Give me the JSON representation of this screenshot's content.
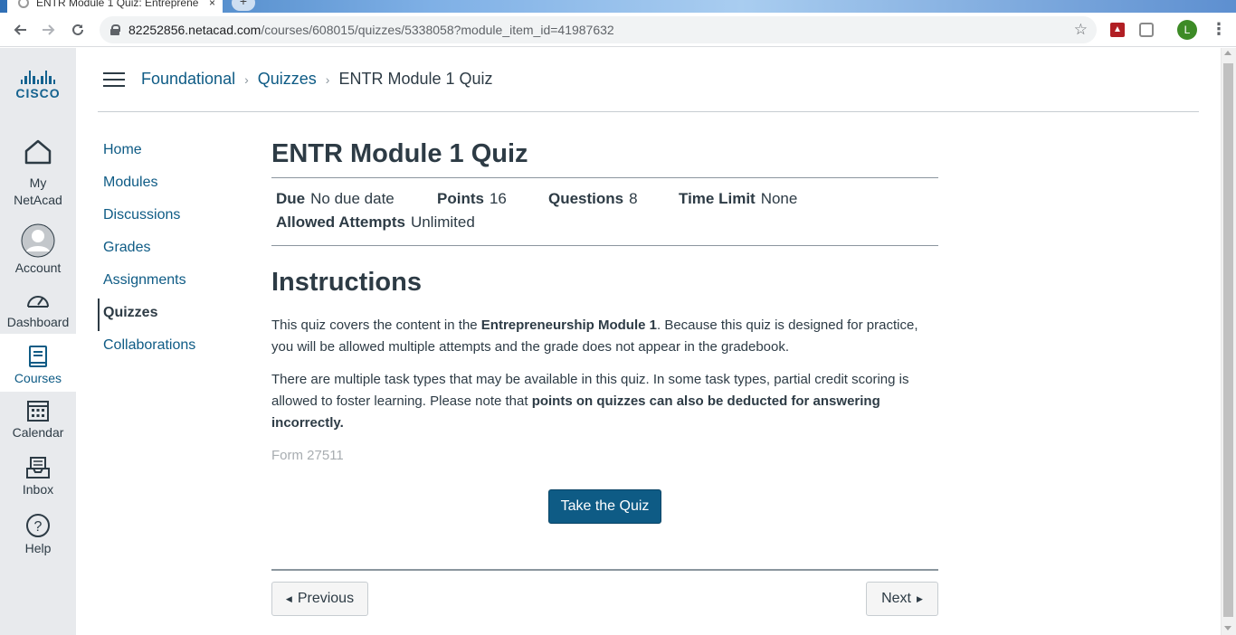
{
  "browser": {
    "tab_title": "ENTR Module 1 Quiz: Entreprene",
    "tab_close": "×",
    "new_tab": "+",
    "url_host": "82252856.netacad.com",
    "url_path": "/courses/608015/quizzes/5338058?module_item_id=41987632",
    "profile_initial": "L"
  },
  "global_nav": {
    "logo_text": "CISCO",
    "items": [
      {
        "label": "My NetAcad",
        "icon": "home-icon"
      },
      {
        "label": "Account",
        "icon": "account-icon"
      },
      {
        "label": "Dashboard",
        "icon": "dashboard-icon"
      },
      {
        "label": "Courses",
        "icon": "courses-icon",
        "active": true
      },
      {
        "label": "Calendar",
        "icon": "calendar-icon"
      },
      {
        "label": "Inbox",
        "icon": "inbox-icon"
      },
      {
        "label": "Help",
        "icon": "help-icon"
      }
    ],
    "my_label_line1": "My",
    "my_label_line2": "NetAcad",
    "help_glyph": "?"
  },
  "breadcrumbs": {
    "course": "Foundational",
    "section": "Quizzes",
    "current": "ENTR Module 1 Quiz",
    "separator": "›"
  },
  "course_nav": {
    "items": [
      "Home",
      "Modules",
      "Discussions",
      "Grades",
      "Assignments",
      "Quizzes",
      "Collaborations"
    ],
    "active": "Quizzes"
  },
  "quiz": {
    "title": "ENTR Module 1 Quiz",
    "due_label": "Due",
    "due_value": "No due date",
    "points_label": "Points",
    "points_value": "16",
    "questions_label": "Questions",
    "questions_value": "8",
    "time_limit_label": "Time Limit",
    "time_limit_value": "None",
    "attempts_label": "Allowed Attempts",
    "attempts_value": "Unlimited"
  },
  "instructions": {
    "heading": "Instructions",
    "p1_a": "This quiz covers the content in the ",
    "p1_b": "Entrepreneurship Module 1",
    "p1_c": ". Because this quiz is designed for practice, you will be allowed multiple attempts and the grade does not appear in the gradebook.",
    "p2_a": "There are multiple task types that may be available in this quiz. In some task types, partial credit scoring is allowed to foster learning. Please note that ",
    "p2_b": "points on quizzes can also be deducted for answering incorrectly.",
    "form_id": "Form 27511"
  },
  "actions": {
    "take_quiz": "Take the Quiz",
    "previous": "Previous",
    "next": "Next"
  }
}
